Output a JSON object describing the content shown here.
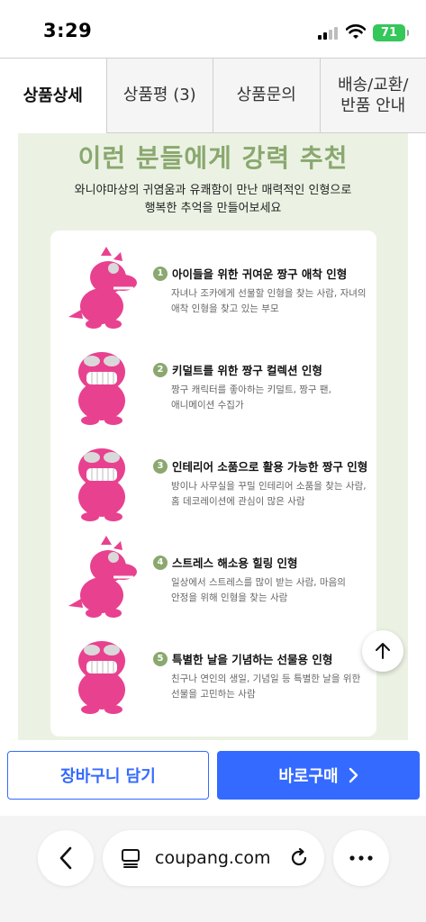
{
  "status_bar": {
    "time": "3:29",
    "battery": "71"
  },
  "tabs": [
    {
      "label": "상품상세"
    },
    {
      "label": "상품평 (3)"
    },
    {
      "label": "상품문의"
    },
    {
      "label": "배송/교환/\n반품 안내"
    }
  ],
  "content": {
    "headline": "이런 분들에게 강력 추천",
    "subline": "와니야마상의 귀염움과 유쾌함이 만난 매력적인 인형으로\n행복한 추억을 만들어보세요",
    "items": [
      {
        "num": "1",
        "title": "아이들을 위한 귀여운 짱구 애착 인형",
        "desc": "자녀나 조카에게 선물할 인형을 찾는 사람, 자녀의\n애착 인형을 찾고 있는 부모",
        "image": "pink-dinosaur-plush-side"
      },
      {
        "num": "2",
        "title": "키덜트를 위한 짱구 컬렉션 인형",
        "desc": "짱구 캐릭터를 좋아하는 키덜트, 짱구 팬,\n애니메이션 수집가",
        "image": "pink-dinosaur-plush-front"
      },
      {
        "num": "3",
        "title": "인테리어 소품으로 활용 가능한 짱구 인형",
        "desc": "방이나 사무실을 꾸밀 인테리어 소품을 찾는 사람,\n홈 데코레이션에 관심이 많은 사람",
        "image": "pink-dinosaur-plush-front"
      },
      {
        "num": "4",
        "title": "스트레스 해소용 힐링 인형",
        "desc": "일상에서 스트레스를 많이 받는 사람, 마음의\n안정을 위해 인형을 찾는 사람",
        "image": "pink-dinosaur-plush-side"
      },
      {
        "num": "5",
        "title": "특별한 날을 기념하는 선물용 인형",
        "desc": "친구나 연인의 생일, 기념일 등 특별한 날을 위한\n선물을 고민하는 사람",
        "image": "pink-dinosaur-plush-front"
      }
    ]
  },
  "buy_bar": {
    "cart_label": "장바구니 담기",
    "buy_label": "바로구매"
  },
  "browser": {
    "url": "coupang.com"
  },
  "colors": {
    "accent_green": "#8aa86f",
    "panel_bg": "#ebf2e3",
    "brand_blue": "#346aff",
    "plush_pink": "#e8418f"
  },
  "icons": [
    "signal-icon",
    "wifi-icon",
    "battery-icon",
    "arrow-up-icon",
    "chevron-right-icon",
    "chevron-left-icon",
    "reader-icon",
    "reload-icon",
    "more-icon"
  ]
}
